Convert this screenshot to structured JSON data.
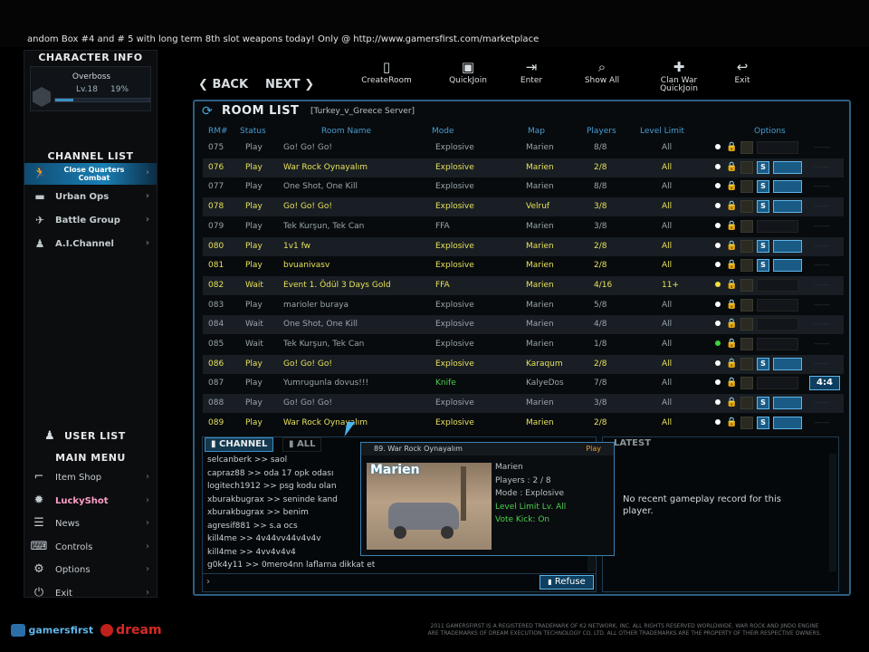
{
  "ticker": "andom Box #4 and # 5 with long term 8th slot weapons today! Only @ http://www.gamersfirst.com/marketplace",
  "character": {
    "header": "CHARACTER INFO",
    "name": "Overboss",
    "level": "Lv.18",
    "percent": "19%",
    "progress": 0.19
  },
  "channel": {
    "header": "CHANNEL LIST",
    "items": [
      {
        "label": "Close Quarters Combat",
        "icon": "soldier-icon",
        "selected": true
      },
      {
        "label": "Urban Ops",
        "icon": "tank-icon",
        "selected": false
      },
      {
        "label": "Battle Group",
        "icon": "jet-icon",
        "selected": false
      },
      {
        "label": "A.I.Channel",
        "icon": "squad-icon",
        "selected": false
      }
    ]
  },
  "user_list": "USER LIST",
  "main_menu": {
    "header": "MAIN MENU",
    "items": [
      {
        "label": "Item Shop",
        "icon": "gun-icon"
      },
      {
        "label": "LuckyShot",
        "icon": "lucky-shot-icon"
      },
      {
        "label": "News",
        "icon": "news-icon"
      },
      {
        "label": "Controls",
        "icon": "keyboard-icon"
      },
      {
        "label": "Options",
        "icon": "gear-icon"
      },
      {
        "label": "Exit",
        "icon": "power-icon"
      }
    ]
  },
  "toolbar": {
    "back": "BACK",
    "next": "NEXT",
    "buttons": [
      {
        "label": "CreateRoom",
        "icon": "door-icon"
      },
      {
        "label": "QuickJoin",
        "icon": "quickjoin-icon"
      },
      {
        "label": "Enter",
        "icon": "enter-icon"
      },
      {
        "label": "Show All",
        "icon": "search-icon"
      },
      {
        "label": "Clan War QuickJoin",
        "icon": "crosshair-icon"
      },
      {
        "label": "Exit",
        "icon": "exit-icon"
      }
    ]
  },
  "room_list": {
    "title": "ROOM LIST",
    "server": "[Turkey_v_Greece Server]",
    "columns": [
      "RM#",
      "Status",
      "Room Name",
      "Mode",
      "Map",
      "Players",
      "Level Limit",
      "Options"
    ],
    "rows": [
      {
        "num": "075",
        "status": "Play",
        "name": "Go! Go! Go!",
        "mode": "Explosive",
        "map": "Marien",
        "players": "8/8",
        "level": "All",
        "hi": false,
        "locked": false,
        "dot": "#ffffff",
        "opts": false
      },
      {
        "num": "076",
        "status": "Play",
        "name": "War Rock Oynayalım",
        "mode": "Explosive",
        "map": "Marien",
        "players": "2/8",
        "level": "All",
        "hi": true,
        "locked": true,
        "dot": "#ffffff",
        "opts": true
      },
      {
        "num": "077",
        "status": "Play",
        "name": "One Shot, One Kill",
        "mode": "Explosive",
        "map": "Marien",
        "players": "8/8",
        "level": "All",
        "hi": false,
        "locked": true,
        "dot": "#ffffff",
        "opts": true
      },
      {
        "num": "078",
        "status": "Play",
        "name": "Go! Go! Go!",
        "mode": "Explosive",
        "map": "Velruf",
        "players": "3/8",
        "level": "All",
        "hi": true,
        "locked": true,
        "dot": "#ffffff",
        "opts": true
      },
      {
        "num": "079",
        "status": "Play",
        "name": "Tek Kurşun, Tek Can",
        "mode": "FFA",
        "map": "Marien",
        "players": "3/8",
        "level": "All",
        "hi": false,
        "locked": false,
        "dot": "#ffffff",
        "opts": false
      },
      {
        "num": "080",
        "status": "Play",
        "name": "1v1 fw",
        "mode": "Explosive",
        "map": "Marien",
        "players": "2/8",
        "level": "All",
        "hi": true,
        "locked": true,
        "dot": "#ffffff",
        "opts": true
      },
      {
        "num": "081",
        "status": "Play",
        "name": "bvuanivasv",
        "mode": "Explosive",
        "map": "Marien",
        "players": "2/8",
        "level": "All",
        "hi": true,
        "locked": true,
        "dot": "#ffffff",
        "opts": true
      },
      {
        "num": "082",
        "status": "Wait",
        "name": "Event 1. Ödül 3 Days Gold",
        "mode": "FFA",
        "map": "Marien",
        "players": "4/16",
        "level": "11+",
        "hi": true,
        "locked": false,
        "dot": "#f0e040",
        "opts": false
      },
      {
        "num": "083",
        "status": "Play",
        "name": "marioler buraya",
        "mode": "Explosive",
        "map": "Marien",
        "players": "5/8",
        "level": "All",
        "hi": false,
        "locked": false,
        "dot": "#ffffff",
        "opts": false
      },
      {
        "num": "084",
        "status": "Wait",
        "name": "One Shot, One Kill",
        "mode": "Explosive",
        "map": "Marien",
        "players": "4/8",
        "level": "All",
        "hi": false,
        "locked": false,
        "dot": "#ffffff",
        "opts": false
      },
      {
        "num": "085",
        "status": "Wait",
        "name": "Tek Kurşun, Tek Can",
        "mode": "Explosive",
        "map": "Marien",
        "players": "1/8",
        "level": "All",
        "hi": false,
        "locked": false,
        "dot": "#40d040",
        "opts": false
      },
      {
        "num": "086",
        "status": "Play",
        "name": "Go! Go! Go!",
        "mode": "Explosive",
        "map": "Karaqum",
        "players": "2/8",
        "level": "All",
        "hi": true,
        "locked": true,
        "dot": "#ffffff",
        "opts": true
      },
      {
        "num": "087",
        "status": "Play",
        "name": "Yumrugunla dovus!!!",
        "mode": "Knife",
        "map": "KalyeDos",
        "players": "7/8",
        "level": "All",
        "hi": false,
        "locked": false,
        "dot": "#ffffff",
        "opts": false,
        "score": "4:4"
      },
      {
        "num": "088",
        "status": "Play",
        "name": "Go! Go! Go!",
        "mode": "Explosive",
        "map": "Marien",
        "players": "3/8",
        "level": "All",
        "hi": false,
        "locked": true,
        "dot": "#ffffff",
        "opts": true
      },
      {
        "num": "089",
        "status": "Play",
        "name": "War Rock Oynayalım",
        "mode": "Explosive",
        "map": "Marien",
        "players": "2/8",
        "level": "All",
        "hi": true,
        "locked": true,
        "dot": "#ffffff",
        "opts": true
      }
    ]
  },
  "chat": {
    "tabs": [
      "CHANNEL",
      "ALL"
    ],
    "lines": [
      "selcanberk >> saol",
      "capraz88  >> oda 17 opk odası",
      "logitech1912 >> psg kodu olan",
      "xburakbugrax >> seninde kand",
      "xburakbugrax >> benim",
      "agresif881 >> s.a ocs",
      "kill4me    >> 4v44vv44v4v4v",
      "kill4me    >> 4vv4v4v4",
      "g0k4y11   >> 0mero4nn laflarna dikkat et"
    ],
    "refuse": "Refuse"
  },
  "latest": {
    "tab": "LATEST",
    "message": "No recent gameplay record for this player."
  },
  "popup": {
    "title": "89. War Rock Oynayalım",
    "status": "Play",
    "map_label": "Marien",
    "info": [
      "Marien",
      "Players : 2 / 8",
      "Mode : Explosive",
      "Level Limit Lv. All",
      "Vote Kick: On"
    ]
  },
  "footer": {
    "brand1": "gamersfirst",
    "brand2": "dream",
    "copyright": "2011 GAMERSFIRST IS A REGISTERED TRADEMARK OF K2 NETWORK, INC. ALL RIGHTS RESERVED WORLDWIDE. WAR ROCK AND JINDO ENGINE ARE TRADEMARKS OF DREAM EXECUTION TECHNOLOGY CO. LTD. ALL OTHER TRADEMARKS ARE THE PROPERTY OF THEIR RESPECTIVE OWNERS."
  },
  "colors": {
    "accent": "#1a7fb5",
    "highlight": "#e8e05a",
    "border": "#2d5f82"
  }
}
